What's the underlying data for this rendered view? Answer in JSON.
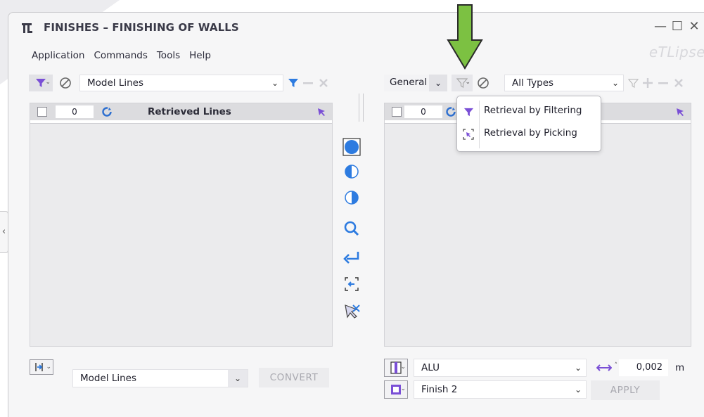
{
  "window": {
    "title": "FINISHES – FINISHING OF WALLS",
    "brand": "eTLipse",
    "minimize_glyph": "—",
    "maximize_glyph": "☐",
    "close_glyph": "✕"
  },
  "menu": {
    "items": [
      "Application",
      "Commands",
      "Tools",
      "Help"
    ]
  },
  "left_panel": {
    "source_select": "Model Lines",
    "count": "0",
    "header_label": "Retrieved Lines",
    "convert_select": "Model Lines",
    "convert_button": "CONVERT"
  },
  "right_panel": {
    "category_select": "General",
    "type_select": "All Types",
    "count": "0",
    "material_select": "ALU",
    "thickness_value": "0,002",
    "thickness_unit": "m",
    "finish_select": "Finish 2",
    "apply_button": "APPLY"
  },
  "retrieval_menu": {
    "items": [
      {
        "label": "Retrieval by Filtering",
        "icon": "filter-icon"
      },
      {
        "label": "Retrieval by Picking",
        "icon": "pick-icon"
      }
    ]
  },
  "colors": {
    "accent_purple": "#7a4fd6",
    "accent_blue": "#2d7be0",
    "annotation_green": "#7cc142"
  }
}
